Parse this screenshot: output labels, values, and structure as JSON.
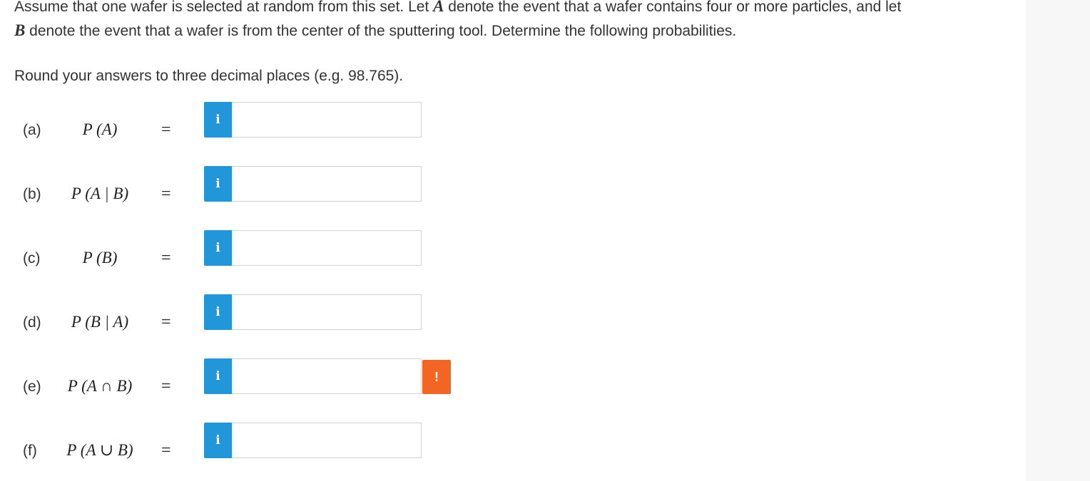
{
  "intro": {
    "line1_pre": "Assume that one wafer is selected at random from this set. Let ",
    "var_a": "A",
    "line1_post": " denote the event that a wafer contains four or more particles, and let",
    "var_b": "B",
    "line2_post": " denote the event that a wafer is from the center of the sputtering tool. Determine the following probabilities."
  },
  "instruction": "Round your answers to three decimal places (e.g. 98.765).",
  "equals_sign": "=",
  "info_icon": "i",
  "warning_icon": "!",
  "colors": {
    "info_button": "#2196d9",
    "warning_button": "#f26522",
    "text": "#333333"
  },
  "questions": [
    {
      "label": "(a)",
      "expression": "P (A)",
      "value": ""
    },
    {
      "label": "(b)",
      "expression": "P (A | B)",
      "value": ""
    },
    {
      "label": "(c)",
      "expression": "P (B)",
      "value": ""
    },
    {
      "label": "(d)",
      "expression": "P (B | A)",
      "value": ""
    },
    {
      "label": "(e)",
      "expression": "P (A ∩ B)",
      "value": "",
      "warning": true
    },
    {
      "label": "(f)",
      "expression": "P (A ∪ B)",
      "value": ""
    }
  ]
}
